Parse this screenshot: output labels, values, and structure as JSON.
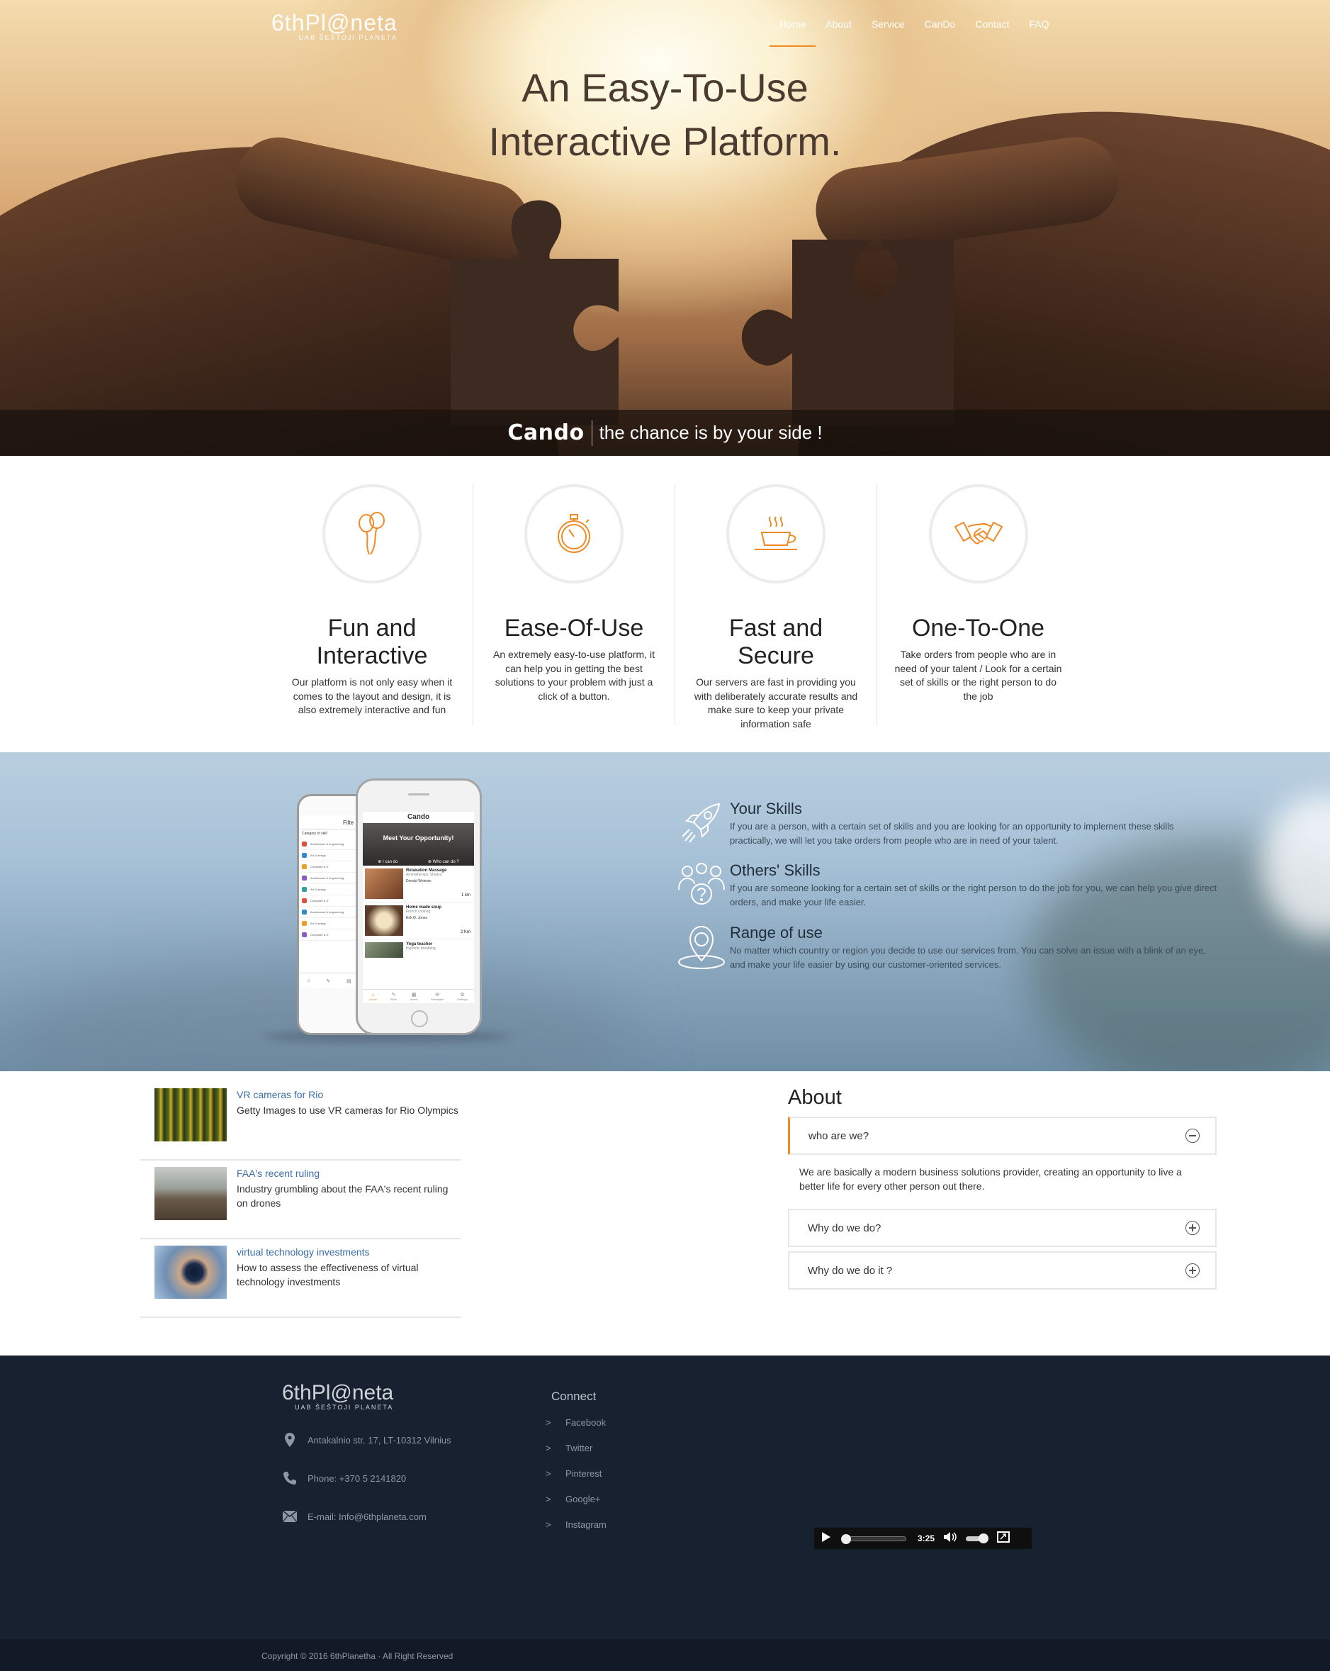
{
  "header": {
    "logo_text": "6thPl@neta",
    "logo_sub": "UAB ŠEŠTOJI PLANETA",
    "nav": [
      "Home",
      "About",
      "Service",
      "CanDo",
      "Contact",
      "FAQ"
    ],
    "active_nav": "Home"
  },
  "hero": {
    "title_line1": "An Easy-To-Use",
    "title_line2": "Interactive Platform.",
    "brand": "Cando",
    "slogan": "the chance is by your side !"
  },
  "features": [
    {
      "icon": "balloons-icon",
      "title": "Fun and Interactive",
      "text": "Our platform is not only easy when it comes to the layout and design, it is also extremely interactive and fun"
    },
    {
      "icon": "stopwatch-icon",
      "title": "Ease-Of-Use",
      "text": "An extremely easy-to-use platform, it can help you in getting the best solutions to your problem with just a click of a button."
    },
    {
      "icon": "coffee-cup-icon",
      "title": "Fast and Secure",
      "text": "Our servers are fast in providing you with deliberately accurate results and make sure to keep your private information safe"
    },
    {
      "icon": "handshake-icon",
      "title": "One-To-One",
      "text": "Take orders from people who are in need of your talent / Look for a certain set of skills or the right person to do the job"
    }
  ],
  "phone": {
    "app_name": "Cando",
    "banner": "Meet Your Opportunity!",
    "btn_i_can_do": "I can do",
    "btn_who_can_do": "Who can do ?",
    "filter_title": "Filte",
    "category_label": "Category of skill",
    "categories": [
      "Architecture & engineering",
      "Art & design",
      "Computer & IT",
      "Architecture & engineering",
      "Art & design",
      "Computer & IT",
      "Architecture & engineering",
      "Art & design",
      "Computer & IT"
    ],
    "listings": [
      {
        "title": "Relaxation Massage",
        "sub": "Aromatherapy, Shiatsu",
        "person": "Donald Weiman",
        "dist": "1 km"
      },
      {
        "title": "Home made soup",
        "sub": "French cooking",
        "person": "Erik O. Jones",
        "dist": "2 Km"
      },
      {
        "title": "Yoga teacher",
        "sub": "Hypnotic breathing",
        "person": "",
        "dist": ""
      }
    ],
    "tabs": [
      "Home",
      "Skills",
      "Invest",
      "Messages",
      "Settings"
    ]
  },
  "skills": [
    {
      "icon": "rocket-icon",
      "title": "Your Skills",
      "text": "If you are a person, with a certain set of skills and you are looking for an opportunity to implement these skills practically, we will let you take orders from people who are in need of your talent."
    },
    {
      "icon": "group-question-icon",
      "title": "Others' Skills",
      "text": "If you are someone looking for a certain set of skills or the right person to do the job for you, we can help you give direct orders, and make your life easier."
    },
    {
      "icon": "location-pin-icon",
      "title": "Range of use",
      "text": "No matter which country or region you decide to use our services from. You can solve an issue with a blink of an eye, and make your life easier by using our customer-oriented services."
    }
  ],
  "news": [
    {
      "link": "VR cameras for Rio",
      "desc": "Getty Images to use VR cameras for Rio Olympics"
    },
    {
      "link": "FAA's recent ruling",
      "desc": "Industry grumbling about the FAA's recent ruling on drones"
    },
    {
      "link": "virtual technology investments",
      "desc": "How to assess the effectiveness of virtual technology investments"
    }
  ],
  "about": {
    "heading": "About",
    "items": [
      {
        "q": "who are we?",
        "a": "We are basically a modern business solutions provider, creating an opportunity to live a better life for every other person out there.",
        "open": true
      },
      {
        "q": "Why do we do?",
        "open": false
      },
      {
        "q": "Why do we do it ?",
        "open": false
      }
    ]
  },
  "footer": {
    "logo_text": "6thPl@neta",
    "logo_sub": "UAB ŠEŠTOJI PLANETA",
    "address": "Antakalnio str. 17, LT-10312 Vilnius",
    "phone": "Phone: +370 5 2141820",
    "email": "E-mail: Info@6thplaneta.com",
    "connect_title": "Connect",
    "social": [
      "Facebook",
      "Twitter",
      "Pinterest",
      "Google+",
      "Instagram"
    ],
    "player_time": "3:25",
    "copyright": "Copyright © 2016 6thPlanetha · All Right Reserved"
  },
  "colors": {
    "accent": "#f08a24",
    "footer": "#17212f",
    "link": "#3a6ea8"
  }
}
